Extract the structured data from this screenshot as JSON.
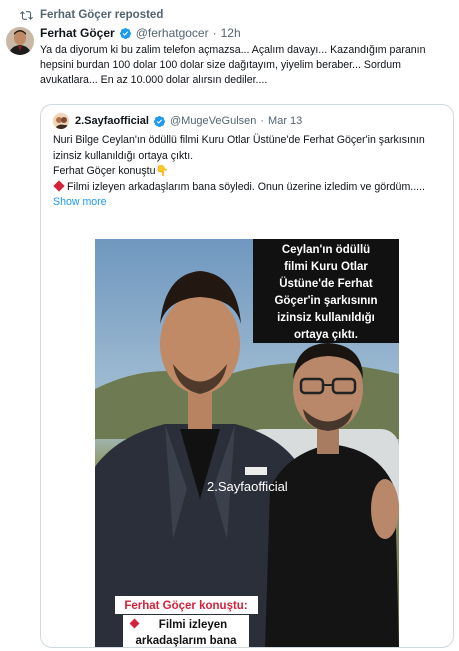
{
  "repost": {
    "text": "Ferhat Göçer reposted",
    "icon": "repost-icon"
  },
  "tweet": {
    "author_name": "Ferhat Göçer",
    "handle": "@ferhatgocer",
    "separator": "·",
    "time": "12h",
    "text": "Ya da diyorum ki bu zalim telefon açmazsa... Açalım davayı... Kazandığım paranın hepsini burdan 100 dolar 100 dolar size dağıtayım, yiyelim beraber... Sordum avukatlara... En az 10.000 dolar alırsın dediler....",
    "verified_icon": "verified-badge-icon"
  },
  "quote": {
    "author_name": "2.Sayfaofficial",
    "handle": "@MugeVeGulsen",
    "separator": "·",
    "time": "Mar 13",
    "line1": "Nuri Bilge Ceylan'ın ödüllü filmi Kuru Otlar Üstüne'de Ferhat Göçer'in şarkısının izinsiz kullanıldığı ortaya çıktı.",
    "line2": "Ferhat Göçer konuştu👇",
    "line3": "Filmi izleyen arkadaşlarım bana söyledi. Onun üzerine izledim ve gördüm.....",
    "show_more": "Show more"
  },
  "media": {
    "caption_top": [
      "Ceylan'ın ödüllü",
      "filmi Kuru Otlar",
      "Üstüne'de Ferhat",
      "Göçer'in şarkısının",
      "izinsiz kullanıldığı",
      "ortaya çıktı."
    ],
    "watermark": "2.Sayfaofficial",
    "caption_bottom_title": "Ferhat Göçer konuştu:",
    "caption_bottom_lines": [
      "Filmi izleyen",
      "arkadaşlarım bana"
    ]
  },
  "colors": {
    "accent": "#1d9bf0",
    "muted_text": "#536471",
    "text": "#0f1419",
    "border": "#cfd9de",
    "caption_bg": "#111111",
    "caption_red": "#d3233a"
  }
}
